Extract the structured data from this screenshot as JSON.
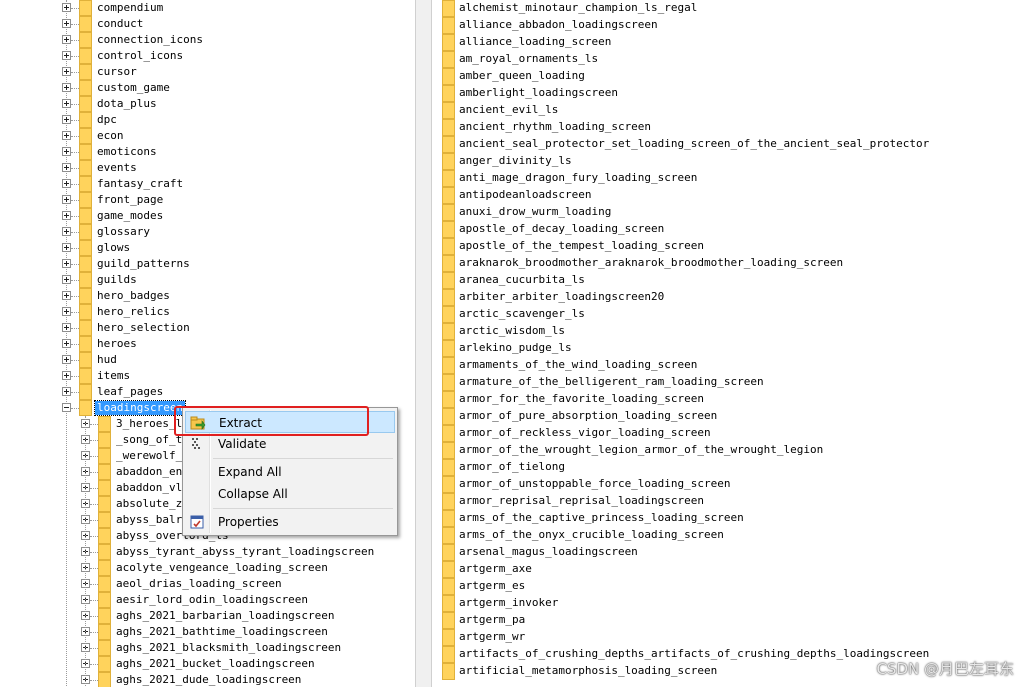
{
  "left_tree": {
    "top_items": [
      "compendium",
      "conduct",
      "connection_icons",
      "control_icons",
      "cursor",
      "custom_game",
      "dota_plus",
      "dpc",
      "econ",
      "emoticons",
      "events",
      "fantasy_craft",
      "front_page",
      "game_modes",
      "glossary",
      "glows",
      "guild_patterns",
      "guilds",
      "hero_badges",
      "hero_relics",
      "hero_selection",
      "heroes",
      "hud",
      "items",
      "leaf_pages"
    ],
    "selected_item": "loadingscreen",
    "children": [
      "3_heroes_lo",
      "_song_of_th",
      "_werewolf_s",
      "abaddon_end",
      "abaddon_vla",
      "absolute_ze",
      "abyss_balro",
      "abyss_overlord_ls",
      "abyss_tyrant_abyss_tyrant_loadingscreen",
      "acolyte_vengeance_loading_screen",
      "aeol_drias_loading_screen",
      "aesir_lord_odin_loadingscreen",
      "aghs_2021_barbarian_loadingscreen",
      "aghs_2021_bathtime_loadingscreen",
      "aghs_2021_blacksmith_loadingscreen",
      "aghs_2021_bucket_loadingscreen",
      "aghs_2021_dude_loadingscreen"
    ]
  },
  "right_list": [
    "alchemist_minotaur_champion_ls_regal",
    "alliance_abbadon_loadingscreen",
    "alliance_loading_screen",
    "am_royal_ornaments_ls",
    "amber_queen_loading",
    "amberlight_loadingscreen",
    "ancient_evil_ls",
    "ancient_rhythm_loading_screen",
    "ancient_seal_protector_set_loading_screen_of_the_ancient_seal_protector",
    "anger_divinity_ls",
    "anti_mage_dragon_fury_loading_screen",
    "antipodeanloadscreen",
    "anuxi_drow_wurm_loading",
    "apostle_of_decay_loading_screen",
    "apostle_of_the_tempest_loading_screen",
    "araknarok_broodmother_araknarok_broodmother_loading_screen",
    "aranea_cucurbita_ls",
    "arbiter_arbiter_loadingscreen20",
    "arctic_scavenger_ls",
    "arctic_wisdom_ls",
    "arlekino_pudge_ls",
    "armaments_of_the_wind_loading_screen",
    "armature_of_the_belligerent_ram_loading_screen",
    "armor_for_the_favorite_loading_screen",
    "armor_of_pure_absorption_loading_screen",
    "armor_of_reckless_vigor_loading_screen",
    "armor_of_the_wrought_legion_armor_of_the_wrought_legion",
    "armor_of_tielong",
    "armor_of_unstoppable_force_loading_screen",
    "armor_reprisal_reprisal_loadingscreen",
    "arms_of_the_captive_princess_loading_screen",
    "arms_of_the_onyx_crucible_loading_screen",
    "arsenal_magus_loadingscreen",
    "artgerm_axe",
    "artgerm_es",
    "artgerm_invoker",
    "artgerm_pa",
    "artgerm_wr",
    "artifacts_of_crushing_depths_artifacts_of_crushing_depths_loadingscreen",
    "artificial_metamorphosis_loading_screen"
  ],
  "context_menu": {
    "extract": "Extract",
    "validate": "Validate",
    "expand_all": "Expand All",
    "collapse_all": "Collapse All",
    "properties": "Properties"
  },
  "watermark": "CSDN @月巴左耳东",
  "colors": {
    "folder": "#ffd35c",
    "selection": "#3399ff",
    "menu_hover": "#cce8ff",
    "highlight": "#e02020"
  },
  "icons": {
    "folder": "folder-icon",
    "extract": "extract-icon",
    "validate": "validate-icon",
    "properties": "properties-icon"
  }
}
